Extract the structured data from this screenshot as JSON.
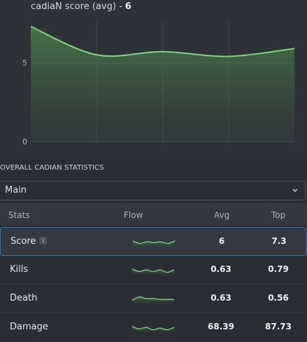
{
  "chart": {
    "title_text": "cadiaN score (avg)",
    "title_sep": "-",
    "title_value": "6",
    "line_color": "#7fd47f"
  },
  "chart_data": {
    "type": "area",
    "title": "cadiaN score (avg) - 6",
    "x": [
      1,
      2,
      3,
      4,
      5
    ],
    "values": [
      7.3,
      5.5,
      5.7,
      5.4,
      5.9
    ],
    "ylim": [
      0,
      8
    ],
    "yticks": [
      "0",
      "5"
    ],
    "grid": true
  },
  "stats": {
    "caption": "OVERALL CADIAN STATISTICS",
    "select_value": "Main",
    "columns": {
      "stats": "Stats",
      "flow": "Flow",
      "avg": "Avg",
      "top": "Top"
    },
    "rows": [
      {
        "name": "Score",
        "avg": "6",
        "top": "7.3",
        "flow": [
          0.6,
          0.3,
          0.5,
          0.4,
          0.5,
          0.3,
          0.6
        ]
      },
      {
        "name": "Kills",
        "avg": "0.63",
        "top": "0.79",
        "flow": [
          0.6,
          0.3,
          0.5,
          0.3,
          0.5,
          0.2,
          0.5
        ]
      },
      {
        "name": "Death",
        "avg": "0.63",
        "top": "0.56",
        "flow": [
          0.3,
          0.7,
          0.5,
          0.5,
          0.4,
          0.4,
          0.4
        ]
      },
      {
        "name": "Damage",
        "avg": "68.39",
        "top": "87.73",
        "flow": [
          0.6,
          0.3,
          0.5,
          0.2,
          0.4,
          0.2,
          0.5
        ]
      }
    ]
  }
}
